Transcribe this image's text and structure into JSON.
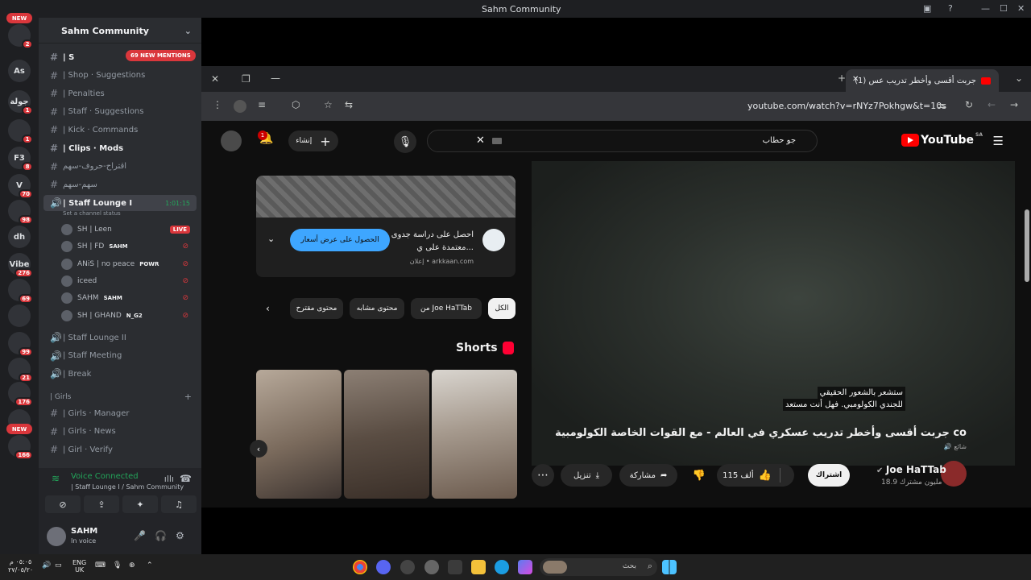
{
  "window": {
    "title": "Sahm Community"
  },
  "server_rail": {
    "items": [
      {
        "label": "",
        "badge": "2",
        "new": true
      },
      {
        "label": "As",
        "badge": ""
      },
      {
        "label": "جولة",
        "badge": "1"
      },
      {
        "label": "",
        "badge": "1"
      },
      {
        "label": "F3",
        "badge": "8"
      },
      {
        "label": "V",
        "badge": "70"
      },
      {
        "label": "",
        "badge": "98"
      },
      {
        "label": "dh",
        "badge": ""
      },
      {
        "label": "Vibe",
        "badge": "276"
      },
      {
        "label": "",
        "badge": "69"
      },
      {
        "label": "",
        "badge": ""
      },
      {
        "label": "",
        "badge": "99"
      },
      {
        "label": "",
        "badge": "21"
      },
      {
        "label": "",
        "badge": "176"
      },
      {
        "label": "",
        "badge": ""
      },
      {
        "label": "",
        "badge": "166",
        "new": true
      }
    ],
    "new_label": "NEW"
  },
  "sidebar": {
    "server_name": "Sahm Community",
    "mentions_badge": "69 NEW MENTIONS",
    "channels": [
      {
        "icon": "💬",
        "name": "| S",
        "bold": true
      },
      {
        "icon": "🛒",
        "name": "| Shop · Suggestions",
        "bold": false
      },
      {
        "icon": "🚫",
        "name": "| Penalties",
        "bold": false
      },
      {
        "icon": "📄",
        "name": "| Staff · Suggestions",
        "bold": false
      },
      {
        "icon": "🟥",
        "name": "| Kick · Commands",
        "bold": false
      },
      {
        "icon": "🎬",
        "name": "| Clips · Mods",
        "bold": true
      },
      {
        "icon": "",
        "name": "اقتراح-حروف-سهم",
        "bold": false
      },
      {
        "icon": "",
        "name": "سهم-سهم",
        "bold": false
      }
    ],
    "voice_channel": {
      "name": "| Staff Lounge I",
      "timer": "1:01:15",
      "status": "Set a channel status"
    },
    "voice_users": [
      {
        "name": "SH | Leen",
        "tag": "",
        "live": true
      },
      {
        "name": "SH | FD",
        "tag": "SAHM",
        "live": false
      },
      {
        "name": "ANiS | no peace",
        "tag": "POWR",
        "live": false
      },
      {
        "name": "iceed",
        "tag": "",
        "live": false
      },
      {
        "name": "SAHM",
        "tag": "SAHM",
        "live": false
      },
      {
        "name": "SH | GHAND",
        "tag": "N_G2",
        "live": false
      }
    ],
    "live_label": "LIVE",
    "other_voice": [
      "| Staff Lounge II",
      "| Staff Meeting",
      "| Break"
    ],
    "category": "| Girls",
    "girls_channels": [
      "| Girls · Manager",
      "| Girls · News",
      "| Girl · Verify"
    ],
    "voice_panel": {
      "status": "Voice Connected",
      "location": "| Staff Lounge I / Sahm Community"
    },
    "user": {
      "name": "SAHM",
      "status": "In voice"
    }
  },
  "browser": {
    "tab_title": "(1) جربت أقسى وأخطر تدريب عس",
    "url": "youtube.com/watch?v=rNYz7Pokhgw&t=10s"
  },
  "youtube": {
    "logo_text": "YouTube",
    "region": "SA",
    "search_query": "جو حطاب",
    "notification_count": "1",
    "create_label": "إنشاء",
    "subtitle_lines": [
      "ستشعر بالشعور الحقيقي",
      "للجندي الكولومبي.  فهل أنت مستعد"
    ],
    "video_title": "جربت أقسى وأخطر تدريب عسكري في العالم - مع القوات الخاصة الكولومبية co",
    "video_meta": "🔊 شائع",
    "channel_name": "Joe HaTTab",
    "subscribers": "18.9 مليون مشترك",
    "subscribe_label": "اشتراك",
    "likes_label": "115 ألف",
    "share_label": "مشاركة",
    "download_label": "تنزيل",
    "ad": {
      "title": "احصل على دراسة جدوى معتمدة على ي...",
      "source": "إعلان • arkkaan.com",
      "cta": "الحصول على عرض أسعار"
    },
    "chips": [
      "الكل",
      "من Joe HaTTab",
      "محتوى مشابه",
      "محتوى مقترح"
    ],
    "shorts_title": "Shorts"
  },
  "taskbar": {
    "search_placeholder": "بحث",
    "lang_top": "ENG",
    "lang_bottom": "UK",
    "time": "٠٥:٠٥ م",
    "date": "٢٧/٠٥/٢٠"
  },
  "colors": {
    "discord_bg": "#2b2d31",
    "youtube_bg": "#0f0f0f",
    "live_red": "#da373c",
    "voice_green": "#23a55a",
    "yt_blue": "#3ea6ff"
  }
}
